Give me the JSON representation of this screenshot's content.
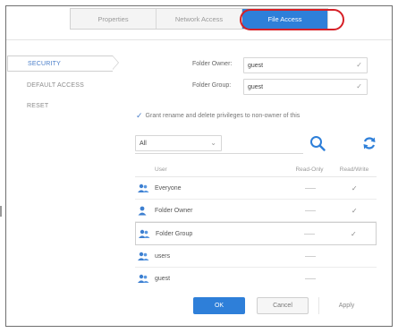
{
  "tabs": [
    {
      "label": "Properties",
      "active": false
    },
    {
      "label": "Network Access",
      "active": false
    },
    {
      "label": "File Access",
      "active": true
    }
  ],
  "sidebar": {
    "items": [
      {
        "label": "SECURITY",
        "active": true
      },
      {
        "label": "DEFAULT ACCESS",
        "active": false
      },
      {
        "label": "RESET",
        "active": false
      }
    ]
  },
  "owner": {
    "folder_owner_label": "Folder Owner:",
    "folder_owner_value": "guest",
    "folder_group_label": "Folder Group:",
    "folder_group_value": "guest"
  },
  "grant_option": {
    "checked": true,
    "label": "Grant rename and delete privileges to non-owner of this"
  },
  "filter": {
    "value": "All"
  },
  "table": {
    "headers": {
      "name": "User",
      "read_only": "Read-Only",
      "read_write": "Read/Write"
    },
    "rows": [
      {
        "name": "Everyone",
        "icon": "group-icon",
        "read_only": false,
        "read_write": true,
        "selected": false
      },
      {
        "name": "Folder Owner",
        "icon": "user-icon",
        "read_only": false,
        "read_write": true,
        "selected": false
      },
      {
        "name": "Folder Group",
        "icon": "group-icon",
        "read_only": false,
        "read_write": true,
        "selected": true
      },
      {
        "name": "users",
        "icon": "group-icon",
        "read_only": false,
        "read_write": false,
        "selected": false
      },
      {
        "name": "guest",
        "icon": "group-icon",
        "read_only": false,
        "read_write": false,
        "selected": false
      }
    ]
  },
  "buttons": {
    "ok": "OK",
    "cancel": "Cancel",
    "apply": "Apply"
  },
  "colors": {
    "accent": "#2e7fd9",
    "highlight_ring": "#d61f26"
  }
}
